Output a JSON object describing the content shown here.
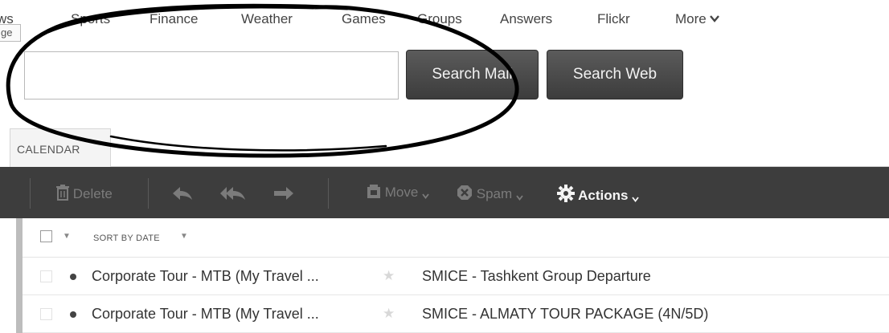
{
  "nav": {
    "items": [
      "ws",
      "Sports",
      "Finance",
      "Weather",
      "Games",
      "Groups",
      "Answers",
      "Flickr",
      "More"
    ],
    "page_tab": "ge"
  },
  "search": {
    "value": "",
    "placeholder": "",
    "mail_button": "Search Mail",
    "web_button": "Search Web"
  },
  "tabs": {
    "calendar": "CALENDAR"
  },
  "toolbar": {
    "delete": "Delete",
    "move": "Move",
    "spam": "Spam",
    "actions": "Actions"
  },
  "list": {
    "sort_label": "SORT BY DATE",
    "messages": [
      {
        "sender": "Corporate Tour - MTB (My Travel ...",
        "subject": "SMICE - Tashkent Group Departure"
      },
      {
        "sender": "Corporate Tour - MTB (My Travel ...",
        "subject": "SMICE - ALMATY TOUR PACKAGE (4N/5D)"
      }
    ]
  },
  "colors": {
    "toolbar_bg": "#3d3d3d",
    "button_bg": "#4a4a4a",
    "annotation_ink": "#000000"
  },
  "icons": [
    "trash-icon",
    "reply-icon",
    "reply-all-icon",
    "forward-icon",
    "move-icon",
    "spam-icon",
    "gear-icon",
    "chevron-down-icon",
    "star-icon"
  ]
}
